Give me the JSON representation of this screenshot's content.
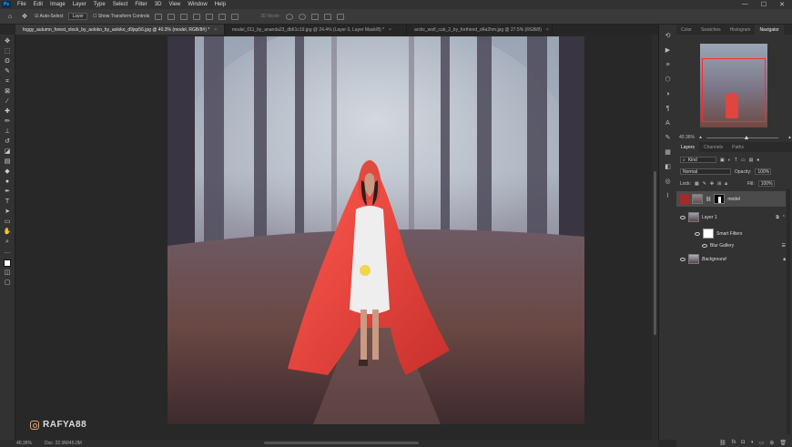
{
  "menubar": {
    "logo": "Ps",
    "items": [
      "File",
      "Edit",
      "Image",
      "Layer",
      "Type",
      "Select",
      "Filter",
      "3D",
      "View",
      "Window",
      "Help"
    ],
    "window_controls": [
      "—",
      "☐",
      "✕"
    ]
  },
  "options": {
    "autoselect_label": "Auto-Select",
    "autoselect_target": "Layer",
    "transform_label": "Show Transform Controls",
    "mode_3d": "3D Mode:"
  },
  "tabs": [
    {
      "label": "foggy_autumn_forest_stock_by_aoloko_by_aoloko_d9jsp56.jpg @ 40.3% (model, RGB/8#) *",
      "active": true
    },
    {
      "label": "model_011_by_ananda23_db61c19.jpg @ 24.4% (Layer 0, Layer Mask/8) *",
      "active": false
    },
    {
      "label": "arctic_wolf_cub_2_by_forthired_d4a2hm.jpg @ 27.5% (RGB/8)",
      "active": false
    }
  ],
  "status": {
    "zoom": "40.36%",
    "doc": "Doc: 22.9M/45.0M"
  },
  "watermark": "RAFYA88",
  "panels": {
    "top_tabs": [
      "Color",
      "Swatches",
      "Histogram",
      "Navigator"
    ],
    "zoom": "40.36%",
    "layer_tabs": [
      "Layers",
      "Channels",
      "Paths"
    ],
    "kind": "Kind",
    "blend_mode": "Normal",
    "opacity_label": "Opacity:",
    "opacity_value": "100%",
    "lock_label": "Lock:",
    "fill_label": "Fill:",
    "fill_value": "100%",
    "layers": [
      {
        "name": "model",
        "selected": true
      },
      {
        "name": "Layer 1",
        "selected": false
      },
      {
        "name": "Smart Filters",
        "selected": false
      },
      {
        "name": "Blur Gallery",
        "selected": false
      },
      {
        "name": "Background",
        "selected": false
      }
    ]
  },
  "colors": {
    "accent_red": "#e0453f",
    "ui_bg": "#282828",
    "panel_bg": "#323232"
  }
}
